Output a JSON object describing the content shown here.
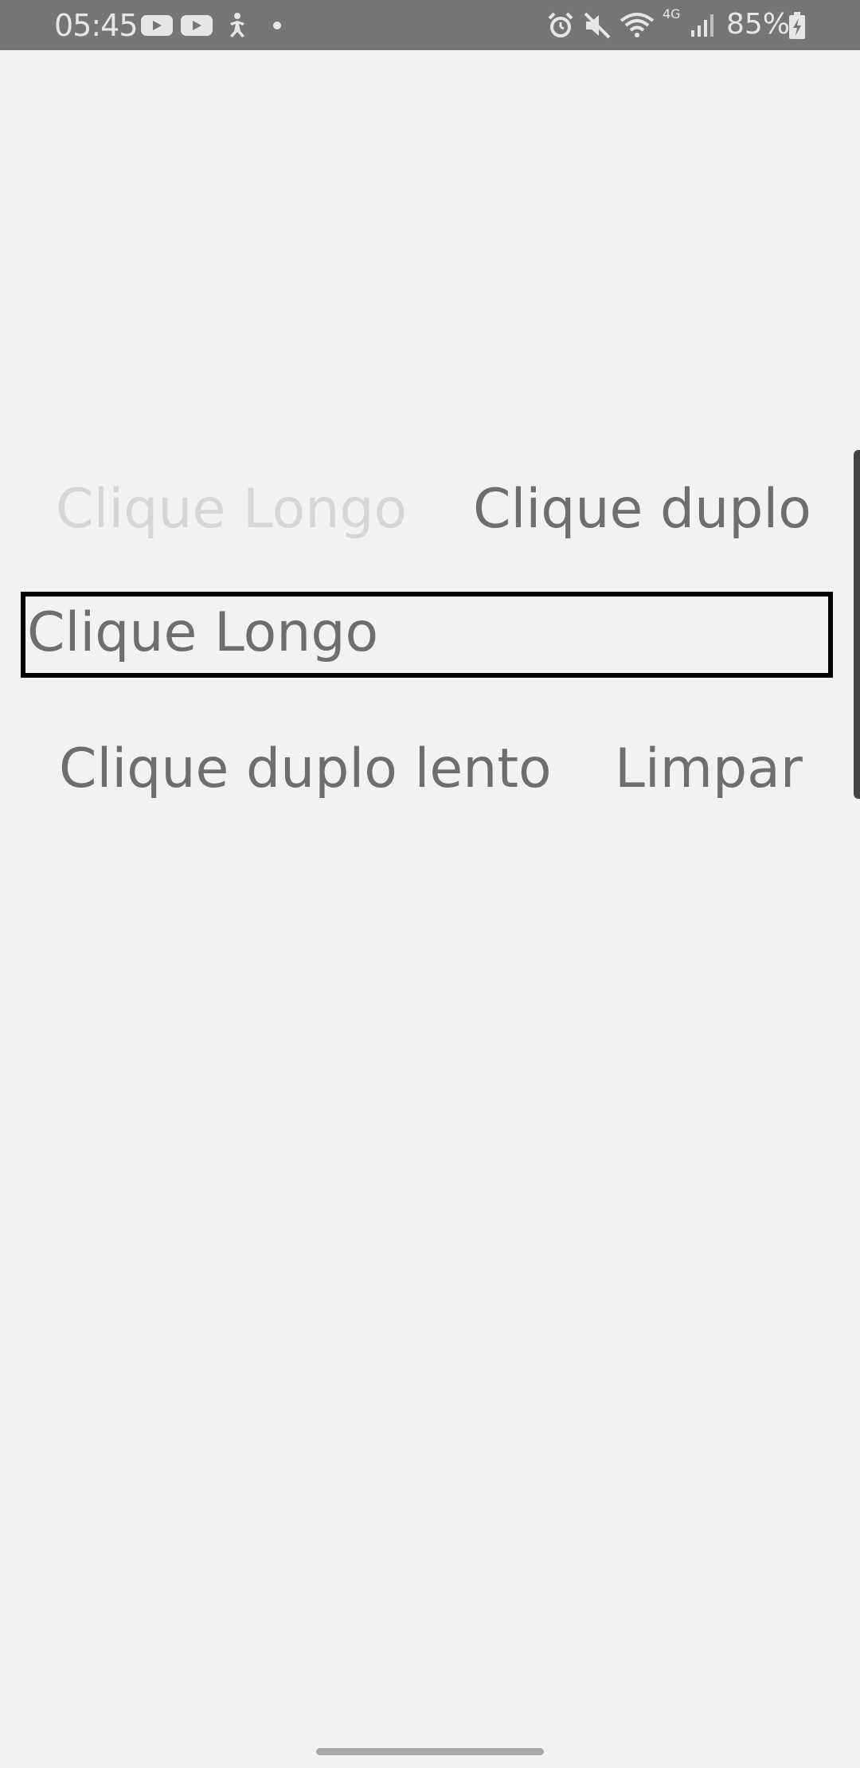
{
  "status_bar": {
    "time": "05:45",
    "network_label": "4G",
    "battery_text": "85%",
    "icons": [
      "youtube-icon",
      "youtube-icon",
      "accessibility-icon",
      "dot-icon",
      "alarm-icon",
      "mute-icon",
      "wifi-icon",
      "signal-icon",
      "battery-charging-icon"
    ]
  },
  "buttons": {
    "long_click": "Clique Longo",
    "double_click": "Clique duplo",
    "slow_double_click": "Clique duplo lento",
    "clear": "Limpar"
  },
  "result": {
    "text": "Clique Longo"
  }
}
